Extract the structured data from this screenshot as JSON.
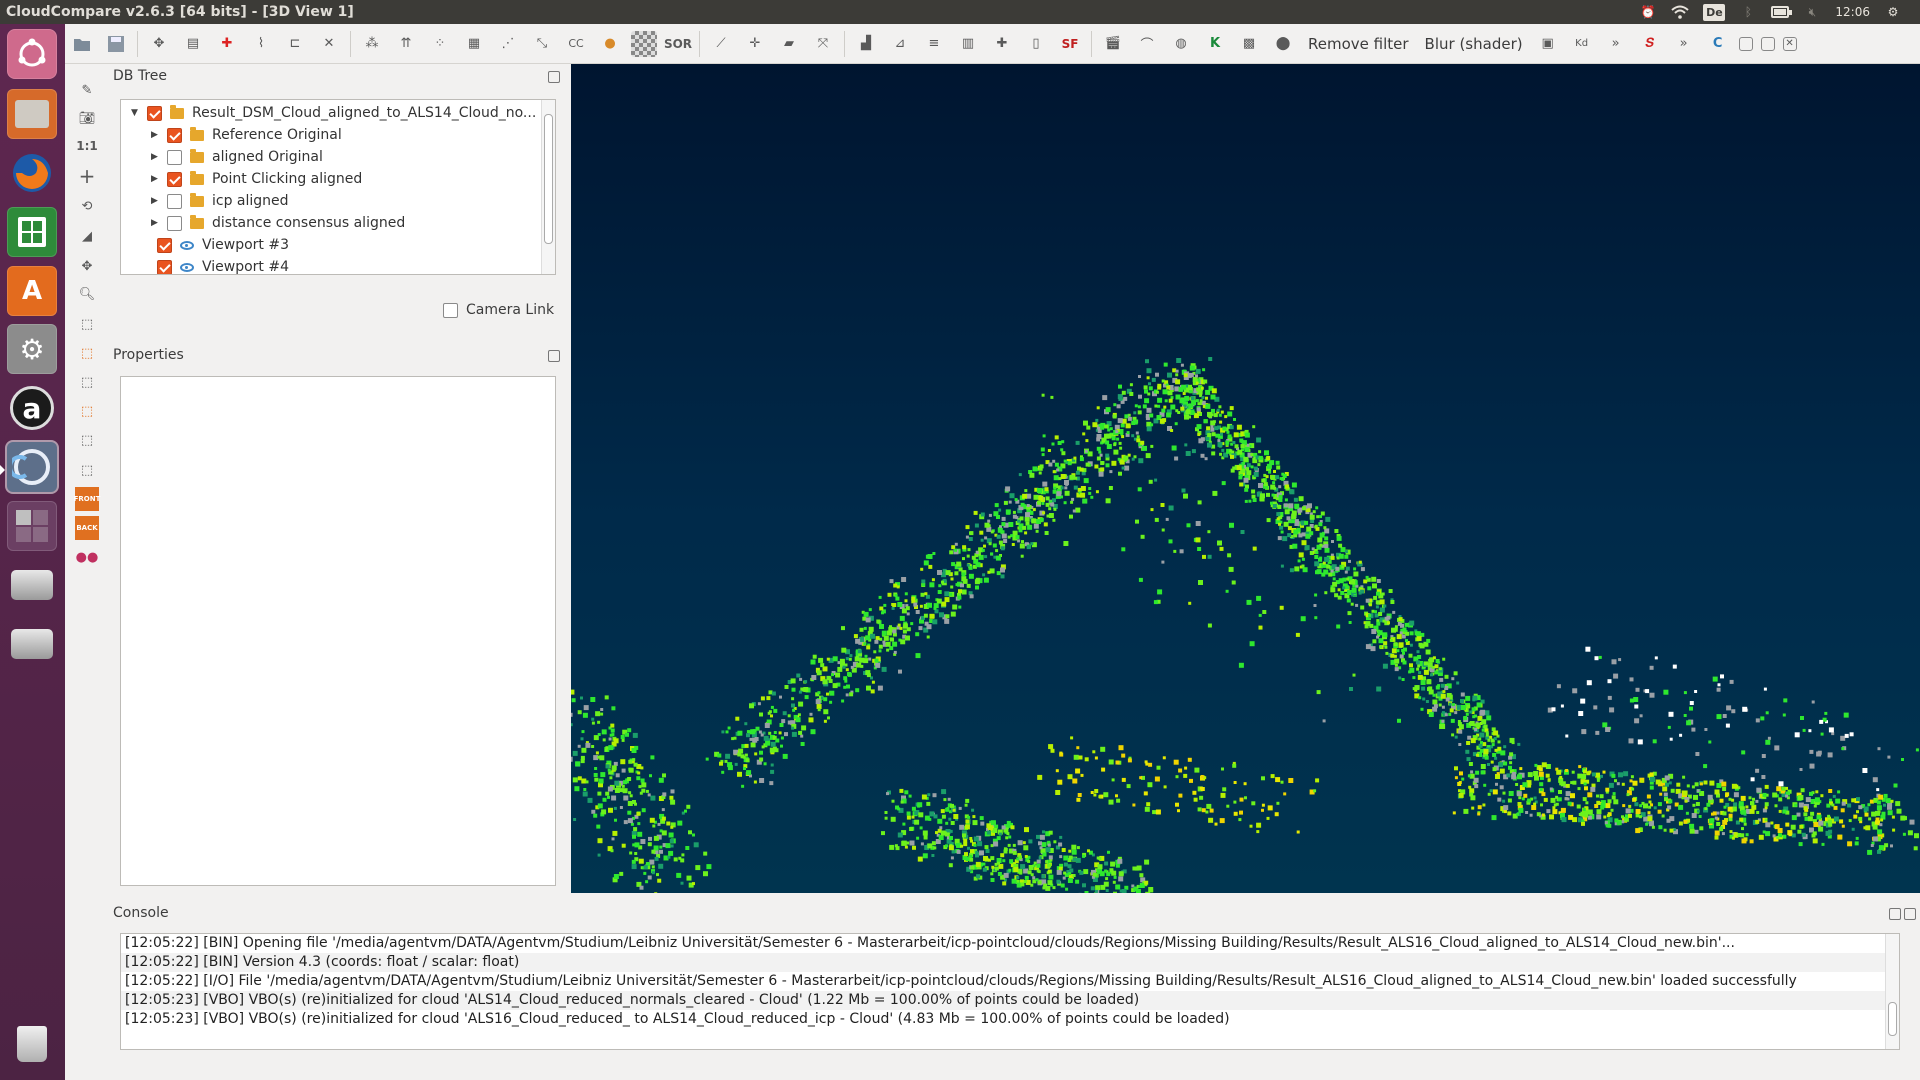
{
  "window": {
    "title": "CloudCompare v2.6.3 [64 bits] - [3D View 1]"
  },
  "system": {
    "keyboard_layout": "De",
    "clock": "12:06",
    "battery_level": 0.85,
    "icons": [
      "alarm-icon",
      "wifi-icon",
      "keyboard-layout-icon",
      "bluetooth-icon",
      "battery-icon",
      "volume-icon",
      "gear-icon"
    ]
  },
  "launcher": {
    "items": [
      "ubuntu-dash",
      "file-manager",
      "firefox",
      "libreoffice-calc",
      "software-center",
      "system-settings",
      "amazon",
      "cloudcompare",
      "workspace-switcher",
      "drive-1",
      "drive-2",
      "trash"
    ]
  },
  "toolbar": {
    "remove_filter_label": "Remove filter",
    "blur_shader_label": "Blur (shader)",
    "sor_label": "SOR",
    "sf_label": "SF",
    "cc_label": "CC",
    "kd_label": "Kd",
    "overflow_label": "»"
  },
  "side_tools": {
    "ratio_label": "1:1",
    "front_label": "FRONT",
    "back_label": "BACK"
  },
  "db_tree": {
    "title": "DB Tree",
    "items": [
      {
        "label": "Result_DSM_Cloud_aligned_to_ALS14_Cloud_no...",
        "checked": true,
        "type": "folder",
        "expanded": true
      },
      {
        "label": "Reference Original",
        "checked": true,
        "type": "folder"
      },
      {
        "label": "aligned Original",
        "checked": false,
        "type": "folder"
      },
      {
        "label": "Point Clicking aligned",
        "checked": true,
        "type": "folder"
      },
      {
        "label": "icp aligned",
        "checked": false,
        "type": "folder"
      },
      {
        "label": "distance consensus aligned",
        "checked": false,
        "type": "folder"
      },
      {
        "label": "Viewport #3",
        "checked": true,
        "type": "viewport"
      },
      {
        "label": "Viewport #4",
        "checked": true,
        "type": "viewport"
      }
    ],
    "camera_link_label": "Camera Link",
    "camera_link_checked": false
  },
  "properties": {
    "title": "Properties"
  },
  "console": {
    "title": "Console",
    "lines": [
      "[12:05:22] [BIN] Opening file '/media/agentvm/DATA/Agentvm/Studium/Leibniz Universität/Semester 6 - Masterarbeit/icp-pointcloud/clouds/Regions/Missing Building/Results/Result_ALS16_Cloud_aligned_to_ALS14_Cloud_new.bin'...",
      "[12:05:22] [BIN] Version 4.3 (coords: float / scalar: float)",
      "[12:05:22] [I/O] File '/media/agentvm/DATA/Agentvm/Studium/Leibniz Universität/Semester 6 - Masterarbeit/icp-pointcloud/clouds/Regions/Missing Building/Results/Result_ALS16_Cloud_aligned_to_ALS14_Cloud_new.bin' loaded successfully",
      "[12:05:23] [VBO] VBO(s) (re)initialized for cloud 'ALS14_Cloud_reduced_normals_cleared - Cloud' (1.22 Mb = 100.00% of points could be loaded)",
      "[12:05:23] [VBO] VBO(s) (re)initialized for cloud 'ALS16_Cloud_reduced_ to ALS14_Cloud_reduced_icp - Cloud' (4.83 Mb = 100.00% of points could be loaded)"
    ]
  },
  "view3d": {
    "background_top": "#001530",
    "background_bottom": "#00344f",
    "point_colors": [
      "#2ee82e",
      "#6cf21c",
      "#b8f000",
      "#e8e800",
      "#f0d400",
      "#1a9e6a",
      "#0d6a7a",
      "#9aa0a6"
    ]
  }
}
